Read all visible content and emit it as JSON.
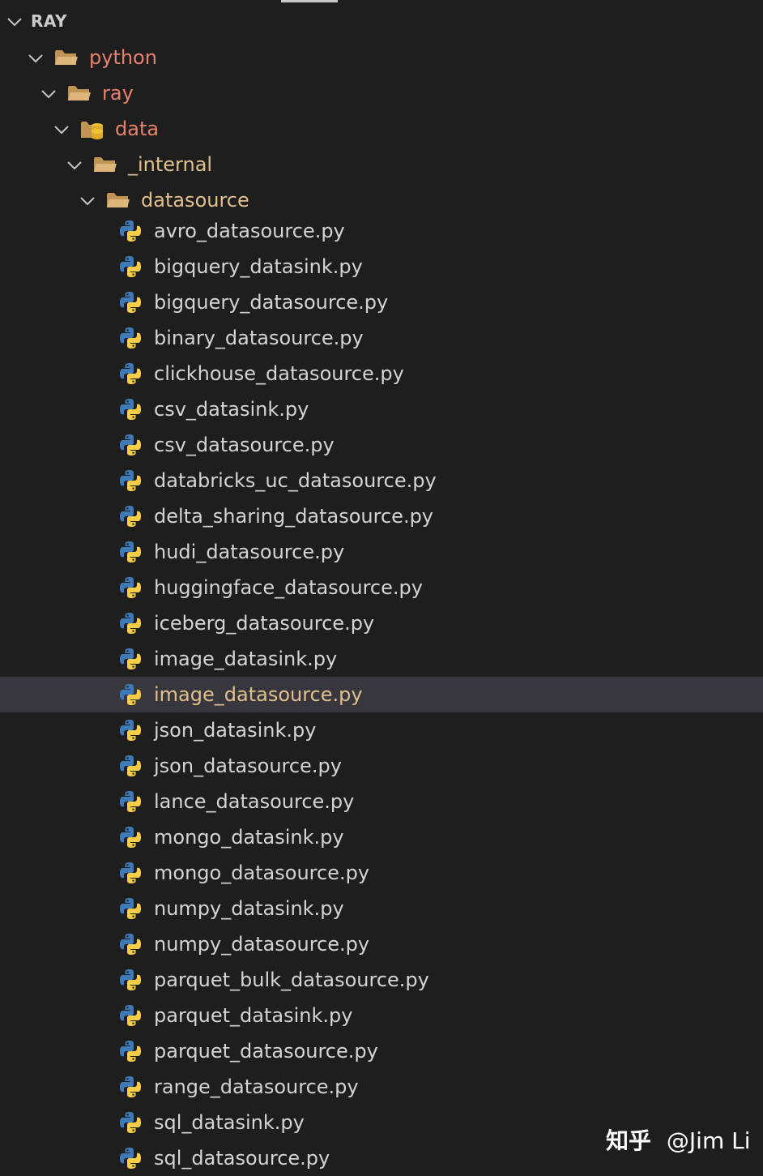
{
  "explorer": {
    "section_title": "RAY",
    "folders": [
      {
        "label": "python"
      },
      {
        "label": "ray"
      },
      {
        "label": "data"
      },
      {
        "label": "_internal"
      },
      {
        "label": "datasource"
      }
    ],
    "files": [
      {
        "label": "avro_datasource.py"
      },
      {
        "label": "bigquery_datasink.py"
      },
      {
        "label": "bigquery_datasource.py"
      },
      {
        "label": "binary_datasource.py"
      },
      {
        "label": "clickhouse_datasource.py"
      },
      {
        "label": "csv_datasink.py"
      },
      {
        "label": "csv_datasource.py"
      },
      {
        "label": "databricks_uc_datasource.py"
      },
      {
        "label": "delta_sharing_datasource.py"
      },
      {
        "label": "hudi_datasource.py"
      },
      {
        "label": "huggingface_datasource.py"
      },
      {
        "label": "iceberg_datasource.py"
      },
      {
        "label": "image_datasink.py"
      },
      {
        "label": "image_datasource.py"
      },
      {
        "label": "json_datasink.py"
      },
      {
        "label": "json_datasource.py"
      },
      {
        "label": "lance_datasource.py"
      },
      {
        "label": "mongo_datasink.py"
      },
      {
        "label": "mongo_datasource.py"
      },
      {
        "label": "numpy_datasink.py"
      },
      {
        "label": "numpy_datasource.py"
      },
      {
        "label": "parquet_bulk_datasource.py"
      },
      {
        "label": "parquet_datasink.py"
      },
      {
        "label": "parquet_datasource.py"
      },
      {
        "label": "range_datasource.py"
      },
      {
        "label": "sql_datasink.py"
      },
      {
        "label": "sql_datasource.py"
      }
    ],
    "selected_file": "image_datasource.py",
    "icons": {
      "chevron": "chevron-down-icon",
      "folder": "folder-open-icon",
      "database_folder": "database-folder-icon",
      "file": "python-icon"
    },
    "colors": {
      "background": "#1e1e1e",
      "selected_row": "#37373d",
      "folder_red": "#e8826f",
      "folder_yellow": "#e2c08d",
      "file_text": "#d4d4d4",
      "python_blue": "#3d7ab8",
      "python_yellow": "#f5cd47"
    }
  },
  "watermark": {
    "brand": "知乎",
    "author": "@Jim Li"
  }
}
